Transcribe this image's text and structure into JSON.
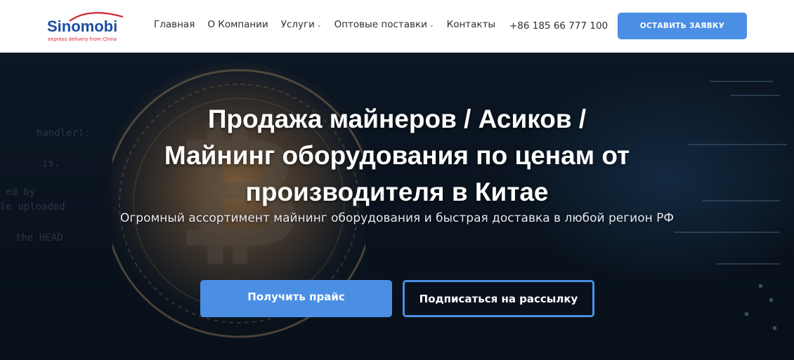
{
  "header": {
    "logo": {
      "name": "Sinomobi",
      "tagline": "express delivery from China"
    },
    "nav": [
      {
        "label": "Главная",
        "has_dropdown": false
      },
      {
        "label": "О Компании",
        "has_dropdown": false
      },
      {
        "label": "Услуги",
        "has_dropdown": true
      },
      {
        "label": "Оптовые поставки",
        "has_dropdown": true
      },
      {
        "label": "Контакты",
        "has_dropdown": false
      }
    ],
    "dropdown_caret": "⌄",
    "phone": "+86 185 66 777 100",
    "cta_label": "ОСТАВИТЬ ЗАЯВКУ"
  },
  "hero": {
    "title_lines": [
      "Продажа майнеров / Асиков /",
      "Майнинг оборудования по ценам от",
      "производителя в Китае"
    ],
    "subtitle": "Огромный ассортимент майнинг оборудования и быстрая доставка в любой регион РФ",
    "primary_button": "Получить прайс",
    "secondary_button": "Подписаться на рассылку",
    "background_code": [
      "handler):",
      "is.",
      "ed by",
      "le uploaded",
      "the HEAD"
    ]
  },
  "colors": {
    "accent": "#4a8fe4",
    "logo_blue": "#1c4fa0",
    "logo_red": "#d3242b",
    "nav_text": "#2b2f36"
  }
}
